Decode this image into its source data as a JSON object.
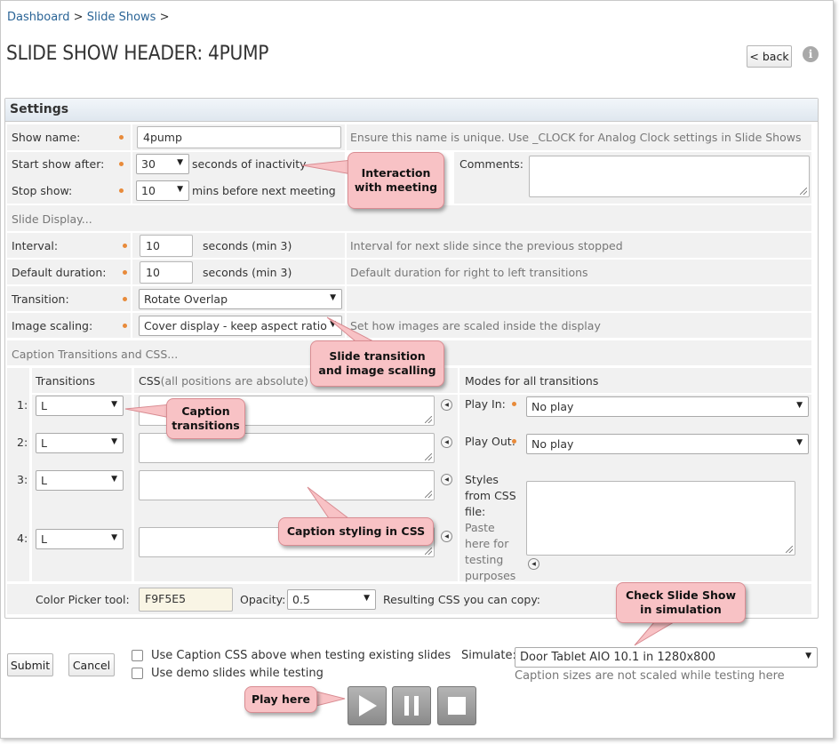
{
  "breadcrumb": {
    "dashboard": "Dashboard",
    "sep1": ">",
    "slide_shows": "Slide Shows",
    "sep2": ">"
  },
  "page_title": "SLIDE SHOW HEADER: 4PUMP",
  "back_button": "< back",
  "info_icon": "i",
  "settings": {
    "title": "Settings",
    "show_name_label": "Show name:",
    "show_name_value": "4pump",
    "show_name_help": "Ensure this name is unique.  Use _CLOCK for Analog Clock settings in Slide Shows",
    "start_label": "Start show after:",
    "start_value": "30",
    "start_suffix": "seconds of inactivity",
    "stop_label": "Stop show:",
    "stop_value": "10",
    "stop_suffix": "mins before next meeting",
    "comments_label": "Comments:",
    "slide_display_heading": "Slide Display...",
    "interval_label": "Interval:",
    "interval_value": "10",
    "interval_suffix": "seconds (min 3)",
    "interval_help": "Interval for next slide since the previous stopped",
    "duration_label": "Default duration:",
    "duration_value": "10",
    "duration_suffix": "seconds (min 3)",
    "duration_help": "Default duration for right to left transitions",
    "transition_label": "Transition:",
    "transition_value": "Rotate Overlap",
    "scaling_label": "Image scaling:",
    "scaling_value": "Cover display - keep aspect ratio",
    "scaling_help": "Set how images are scaled inside the display",
    "caption_heading": "Caption Transitions and CSS...",
    "col_transitions": "Transitions",
    "col_css": "CSS",
    "col_css_note": "(all positions are absolute)",
    "col_modes": "Modes for all transitions",
    "rows": [
      {
        "num": "1:",
        "transition": "L"
      },
      {
        "num": "2:",
        "transition": "L"
      },
      {
        "num": "3:",
        "transition": "L"
      },
      {
        "num": "4:",
        "transition": "L"
      }
    ],
    "play_in_label": "Play In:",
    "play_in_value": "No play",
    "play_out_label": "Play Out:",
    "play_out_value": "No play",
    "styles_label_lines": [
      "Styles",
      "from CSS",
      "file:"
    ],
    "paste_label_lines": [
      "Paste",
      "here for",
      "testing",
      "purposes"
    ],
    "color_picker_label": "Color Picker tool:",
    "color_value": "F9F5E5",
    "opacity_label": "Opacity:",
    "opacity_value": "0.5",
    "resulting_css_label": "Resulting CSS you can copy:"
  },
  "footer": {
    "submit": "Submit",
    "cancel": "Cancel",
    "use_caption_css": "Use Caption CSS above when testing existing slides",
    "use_demo_slides": "Use demo slides while testing",
    "simulate_label": "Simulate:",
    "simulate_value": "Door Tablet AIO 10.1 in 1280x800",
    "simulate_note": "Caption sizes are not scaled while testing here"
  },
  "callouts": {
    "interaction": [
      "Interaction",
      "with meeting"
    ],
    "slide_transition": [
      "Slide transition",
      "and image scalling"
    ],
    "caption_transitions": [
      "Caption",
      "transitions"
    ],
    "caption_css": [
      "Caption styling in CSS"
    ],
    "check_simulation": [
      "Check Slide Show",
      "in simulation"
    ],
    "play_here": [
      "Play here"
    ]
  },
  "colors": {
    "callout_fill": "#f8c2c5",
    "link": "#2a6496",
    "required_dot": "#e88a3a",
    "color_swatch": "#F9F5E5"
  },
  "icons": [
    "info-icon",
    "dropdown-arrow-icon",
    "expand-left-icon",
    "resize-grip-icon",
    "play-icon",
    "pause-icon",
    "stop-icon"
  ]
}
